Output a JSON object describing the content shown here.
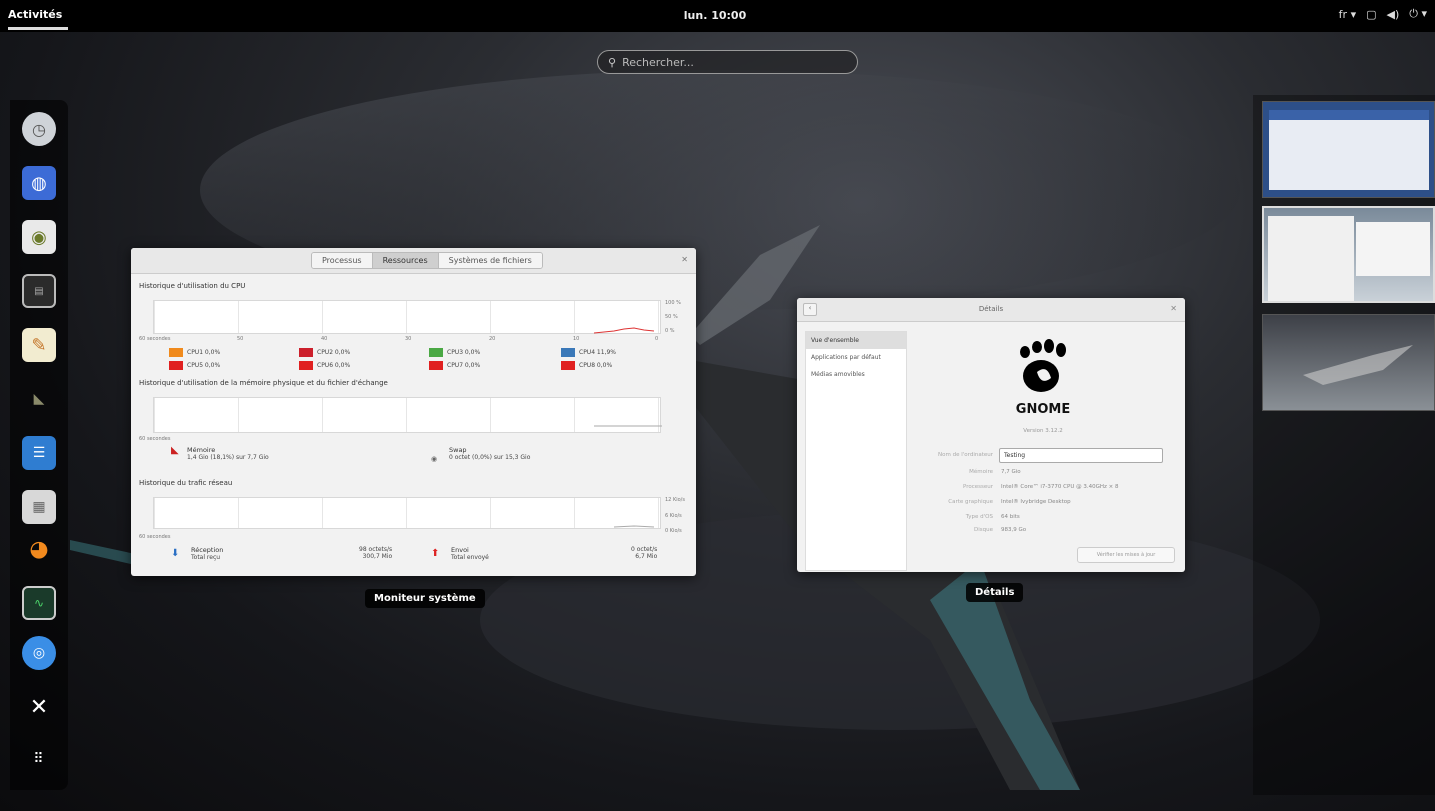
{
  "topbar": {
    "activities": "Activités",
    "clock": "lun. 10:00",
    "input_indicator": "fr ▾",
    "tray_icons": [
      "network-icon",
      "volume-icon",
      "power-icon"
    ]
  },
  "search": {
    "placeholder": "Rechercher..."
  },
  "dash": {
    "apps": [
      "clocks-icon",
      "web-browser-icon",
      "disk-icon",
      "terminal-icon",
      "text-editor-icon",
      "gimp-icon",
      "writer-icon",
      "archive-icon",
      "blender-icon",
      "system-monitor-icon",
      "chromium-icon",
      "tweak-tool-icon",
      "show-apps-grid-icon"
    ]
  },
  "system_monitor": {
    "label": "Moniteur système",
    "tabs": [
      "Processus",
      "Ressources",
      "Systèmes de fichiers"
    ],
    "active_tab": 1,
    "cpu_title": "Historique d'utilisation du CPU",
    "cpu_legend": [
      {
        "label": "CPU1 0,0%",
        "color": "#f08a1c"
      },
      {
        "label": "CPU2 0,0%",
        "color": "#cc1f2b"
      },
      {
        "label": "CPU3 0,0%",
        "color": "#4aa844"
      },
      {
        "label": "CPU4 11,9%",
        "color": "#3a78b8"
      },
      {
        "label": "CPU5 0,0%",
        "color": "#e02020"
      },
      {
        "label": "CPU6 0,0%",
        "color": "#e02020"
      },
      {
        "label": "CPU7 0,0%",
        "color": "#e02020"
      },
      {
        "label": "CPU8 0,0%",
        "color": "#e02020"
      }
    ],
    "mem_title": "Historique d'utilisation de la mémoire physique et du fichier d'échange",
    "memory": {
      "label": "Mémoire",
      "value": "1,4 Gio (18,1%) sur 7,7 Gio"
    },
    "swap": {
      "label": "Swap",
      "value": "0 octet (0,0%) sur 15,3 Gio"
    },
    "net_title": "Historique du trafic réseau",
    "receiving": {
      "label": "Réception",
      "value": "Total reçu"
    },
    "recv_rate": {
      "label": "98 octets/s",
      "value": "300,7 Mio"
    },
    "sending": {
      "label": "Envoi",
      "value": "Total envoyé"
    },
    "send_rate": {
      "label": "0 octet/s",
      "value": "6,7 Mio"
    },
    "axis_left": "60 secondes",
    "axis_ticks": [
      "50",
      "40",
      "30",
      "20",
      "10",
      "0"
    ],
    "cpu_right": [
      "100 %",
      "50 %",
      "0 %"
    ],
    "net_right": [
      "12 Kio/s",
      "6 Kio/s",
      "0 Kio/s"
    ]
  },
  "details": {
    "label": "Détails",
    "title": "Détails",
    "sidebar": [
      "Vue d'ensemble",
      "Applications par défaut",
      "Médias amovibles"
    ],
    "logo_text": "GNOME",
    "version": "Version 3.12.2",
    "device_name_label": "Nom de l'ordinateur",
    "device_name": "Testing",
    "rows": [
      {
        "label": "Mémoire",
        "value": "7,7 Gio"
      },
      {
        "label": "Processeur",
        "value": "Intel® Core™ i7-3770 CPU @ 3.40GHz × 8"
      },
      {
        "label": "Carte graphique",
        "value": "Intel® Ivybridge Desktop"
      },
      {
        "label": "Type d'OS",
        "value": "64 bits"
      },
      {
        "label": "Disque",
        "value": "983,9 Go"
      }
    ],
    "update_button": "Vérifier les mises à jour"
  },
  "workspaces": [
    "workspace-1",
    "workspace-2",
    "workspace-3"
  ]
}
